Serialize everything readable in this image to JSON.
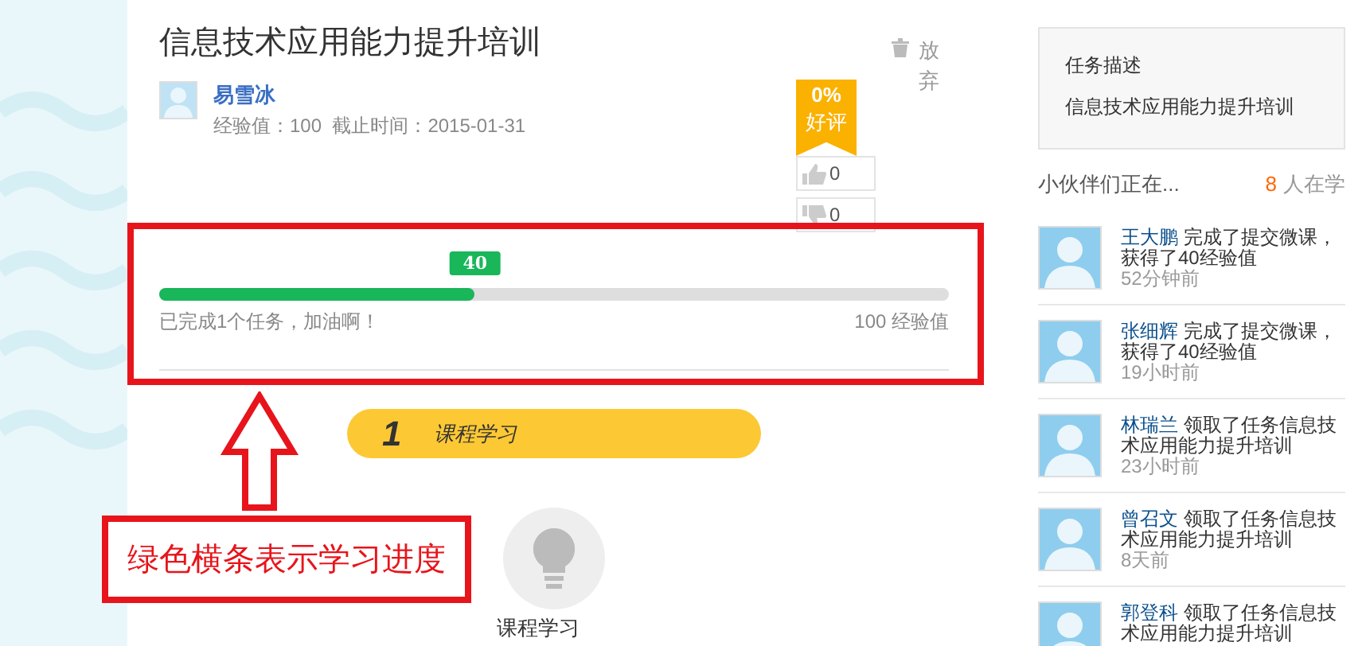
{
  "task": {
    "title": "信息技术应用能力提升培训",
    "quit_label": "放弃",
    "author": "易雪冰",
    "meta": "经验值：100  截止时间：2015-01-31",
    "rating": {
      "percent": "0%",
      "label": "好评"
    },
    "likes": "0",
    "dislikes": "0"
  },
  "progress": {
    "level": 0.4,
    "value_label": "40",
    "status": "已完成1个任务，加油啊！",
    "total": "100 经验值"
  },
  "steps": [
    {
      "number": "1",
      "label": "课程学习"
    }
  ],
  "step_icon_caption": "课程学习",
  "sidebar": {
    "description_title": "任务描述",
    "description": "信息技术应用能力提升培训",
    "learners_title": "小伙伴们正在...",
    "learners_count": "8",
    "learners_suffix": "人在学",
    "activities": [
      {
        "name": "王大鹏",
        "action": "完成了提交微课，获得了40经验值",
        "time": "52分钟前"
      },
      {
        "name": "张细辉",
        "action": "完成了提交微课，获得了40经验值",
        "time": "19小时前"
      },
      {
        "name": "林瑞兰",
        "action": "领取了任务信息技术应用能力提升培训",
        "time": "23小时前"
      },
      {
        "name": "曾召文",
        "action": "领取了任务信息技术应用能力提升培训",
        "time": "8天前"
      },
      {
        "name": "郭登科",
        "action": "领取了任务信息技术应用能力提升培训"
      }
    ]
  },
  "annotation": {
    "text": "绿色横条表示学习进度"
  }
}
